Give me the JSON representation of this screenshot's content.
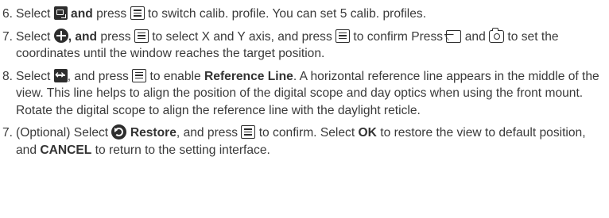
{
  "steps": [
    {
      "num": "6.",
      "t1": "Select ",
      "t2": " and",
      "t3": " press ",
      "t4": " to switch calib. profile. You can set 5 calib. profiles."
    },
    {
      "num": "7.",
      "t1": "Select ",
      "t2": ", and",
      "t3": " press ",
      "t4": " to select X and Y axis, and press ",
      "t5": " to confirm Press ",
      "t6": " and ",
      "t7": " to set the coordinates until the window reaches the target position."
    },
    {
      "num": "8.",
      "t1": "Select ",
      "t2": ", and press ",
      "t3": " to enable ",
      "t4": "Reference Line",
      "t5": ". A horizontal reference line appears in the middle of the view. This line helps to align the position of the digital scope and day optics when using the front mount. Rotate the digital scope to align the reference line with the daylight reticle."
    },
    {
      "num": "7.",
      "t1": "(Optional) Select ",
      "t2": "Restore",
      "t3": ", and press ",
      "t4": " to confirm. Select ",
      "t5": "OK",
      "t6": " to restore the view to default position, and ",
      "t7": "CANCEL",
      "t8": " to return to the setting interface."
    }
  ],
  "icons": {
    "calib_profile": "calib-profile-icon",
    "menu": "menu-button-icon",
    "move": "move-window-icon",
    "picture": "picture-icon",
    "camera": "camera-icon",
    "reference_line": "reference-line-icon",
    "restore": "restore-icon"
  }
}
